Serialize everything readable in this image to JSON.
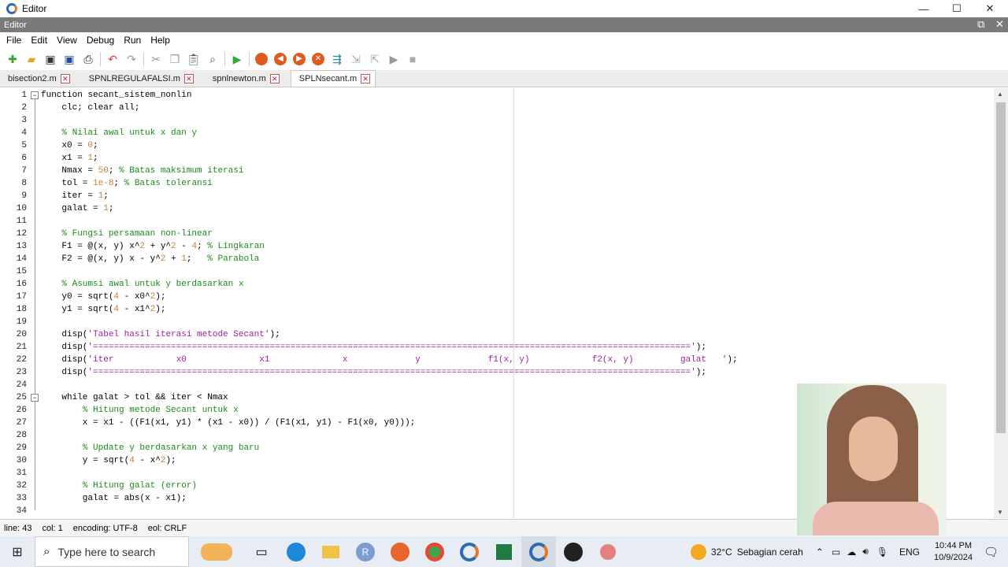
{
  "window": {
    "title": "Editor",
    "pane_title": "Editor",
    "minimize": "—",
    "maximize": "☐",
    "close": "✕"
  },
  "menu": [
    "File",
    "Edit",
    "View",
    "Debug",
    "Run",
    "Help"
  ],
  "tabs": [
    {
      "label": "bisection2.m",
      "active": false
    },
    {
      "label": "SPNLREGULAFALSI.m",
      "active": false
    },
    {
      "label": "spnlnewton.m",
      "active": false
    },
    {
      "label": "SPLNsecant.m",
      "active": true
    }
  ],
  "code": [
    "function secant_sistem_nonlin",
    "    clc; clear all;",
    "",
    "    % Nilai awal untuk x dan y",
    "    x0 = 0;",
    "    x1 = 1;",
    "    Nmax = 50; % Batas maksimum iterasi",
    "    tol = 1e-8; % Batas toleransi",
    "    iter = 1;",
    "    galat = 1;",
    "",
    "    % Fungsi persamaan non-linear",
    "    F1 = @(x, y) x^2 + y^2 - 4; % Lingkaran",
    "    F2 = @(x, y) x - y^2 + 1;   % Parabola",
    "",
    "    % Asumsi awal untuk y berdasarkan x",
    "    y0 = sqrt(4 - x0^2);",
    "    y1 = sqrt(4 - x1^2);",
    "",
    "    disp('Tabel hasil iterasi metode Secant');",
    "    disp('===================================================================================================================');",
    "    disp('iter            x0              x1              x             y             f1(x, y)            f2(x, y)         galat   ');",
    "    disp('===================================================================================================================');",
    "",
    "    while galat > tol && iter < Nmax",
    "        % Hitung metode Secant untuk x",
    "        x = x1 - ((F1(x1, y1) * (x1 - x0)) / (F1(x1, y1) - F1(x0, y0)));",
    "",
    "        % Update y berdasarkan x yang baru",
    "        y = sqrt(4 - x^2);",
    "",
    "        % Hitung galat (error)",
    "        galat = abs(x - x1);",
    ""
  ],
  "status": {
    "line": "line: 43",
    "col": "col: 1",
    "encoding": "encoding: UTF-8",
    "eol": "eol: CRLF"
  },
  "taskbar": {
    "search_placeholder": "Type here to search",
    "weather_temp": "32°C",
    "weather_desc": "Sebagian cerah",
    "language": "ENG",
    "time": "10:44 PM",
    "date": "10/9/2024"
  },
  "colors": {
    "comment": "#1a8a1a",
    "string": "#a020a0",
    "number": "#c0843c",
    "run_green": "#2eaa3a",
    "stop_red": "#e05a1e"
  }
}
